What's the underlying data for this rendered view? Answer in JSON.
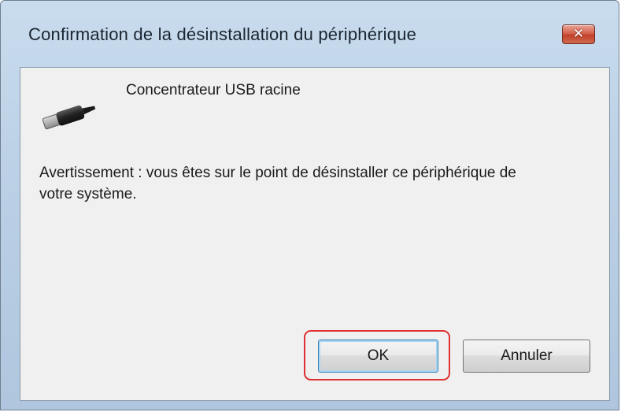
{
  "dialog": {
    "title": "Confirmation de la désinstallation du périphérique",
    "close_icon": "close-icon"
  },
  "device": {
    "icon": "usb-icon",
    "name": "Concentrateur USB racine"
  },
  "message": {
    "warning": "Avertissement : vous êtes sur le point de désinstaller ce périphérique de votre système."
  },
  "buttons": {
    "ok_label": "OK",
    "cancel_label": "Annuler"
  },
  "colors": {
    "highlight": "#e03030",
    "close_button": "#c2412b"
  }
}
